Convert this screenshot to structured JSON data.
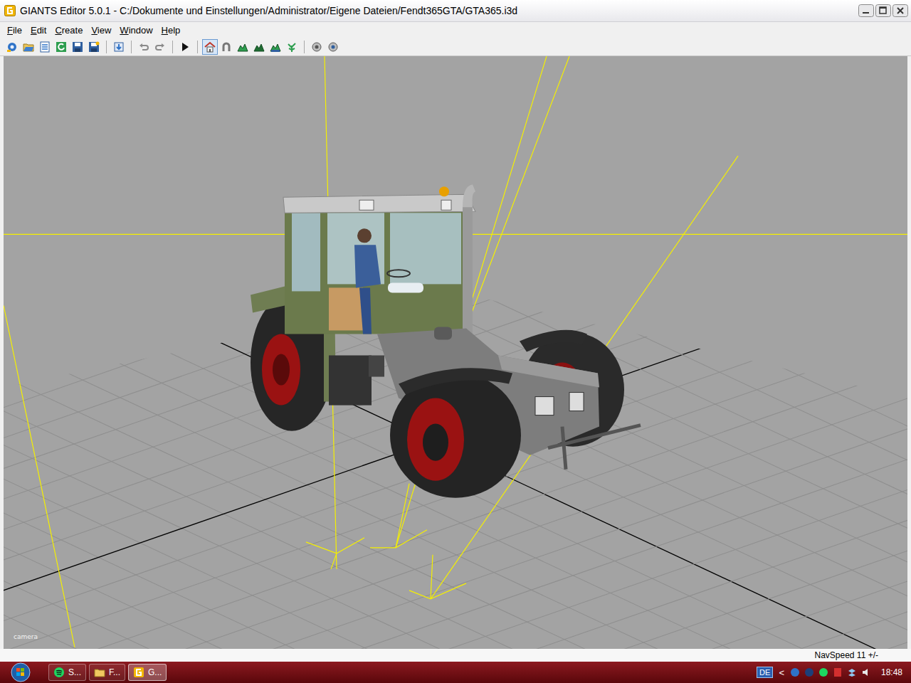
{
  "window": {
    "title": "GIANTS Editor 5.0.1 - C:/Dokumente und Einstellungen/Administrator/Eigene Dateien/Fendt365GTA/GTA365.i3d"
  },
  "menu": [
    "File",
    "Edit",
    "Create",
    "View",
    "Window",
    "Help"
  ],
  "toolbar": [
    {
      "buttons": [
        {
          "selected": false
        },
        {
          "selected": false
        },
        {
          "selected": false
        },
        {
          "selected": false
        },
        {
          "selected": false
        },
        {
          "selected": false
        }
      ]
    },
    {
      "buttons": [
        {
          "selected": false
        }
      ]
    },
    {
      "buttons": [
        {
          "selected": false
        },
        {
          "selected": false
        }
      ]
    },
    {
      "buttons": [
        {
          "selected": false
        }
      ]
    },
    {
      "buttons": [
        {
          "selected": true
        },
        {
          "selected": false
        },
        {
          "selected": false
        },
        {
          "selected": false
        },
        {
          "selected": false
        },
        {
          "selected": false
        }
      ]
    },
    {
      "buttons": [
        {
          "selected": false
        },
        {
          "selected": false
        }
      ]
    }
  ],
  "viewport": {
    "camera_label": "camera"
  },
  "status_bar": {
    "nav_speed": "NavSpeed 11 +/-"
  },
  "taskbar": {
    "buttons": [
      {
        "label": "S...",
        "selected": false
      },
      {
        "label": "F...",
        "selected": false
      },
      {
        "label": "G...",
        "selected": true
      }
    ],
    "language": "DE",
    "tray_toggle": "<",
    "clock": "18:48"
  }
}
